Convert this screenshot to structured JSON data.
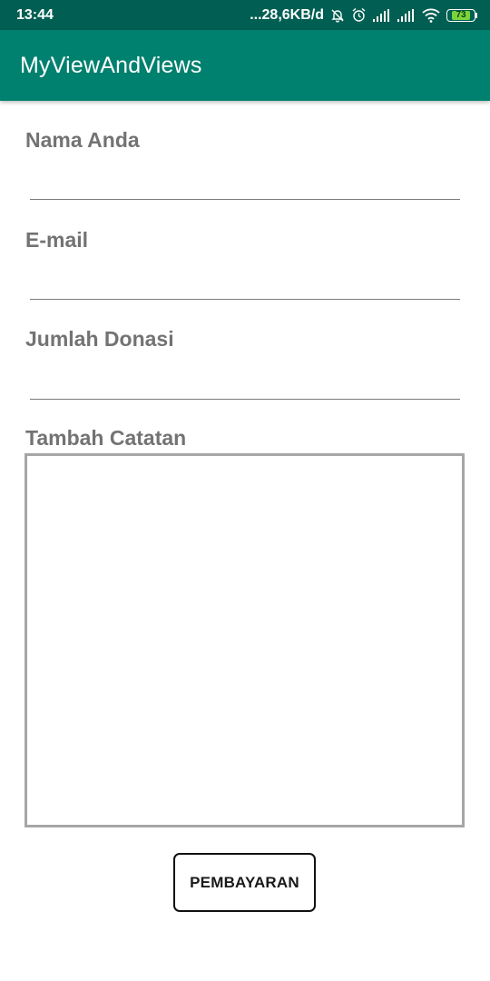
{
  "status_bar": {
    "time": "13:44",
    "network_speed": "...28,6KB/d",
    "battery_level": "73",
    "icons": [
      "mute-icon",
      "alarm-icon",
      "signal-icon",
      "signal-icon",
      "wifi-icon",
      "battery-icon"
    ]
  },
  "app_bar": {
    "title": "MyViewAndViews",
    "color": "#00806e",
    "status_color": "#005f52"
  },
  "form": {
    "name_label": "Nama Anda",
    "name_value": "",
    "email_label": "E-mail",
    "email_value": "",
    "amount_label": "Jumlah Donasi",
    "amount_value": "",
    "notes_label": "Tambah Catatan",
    "notes_value": "",
    "submit_label": "PEMBAYARAN"
  }
}
